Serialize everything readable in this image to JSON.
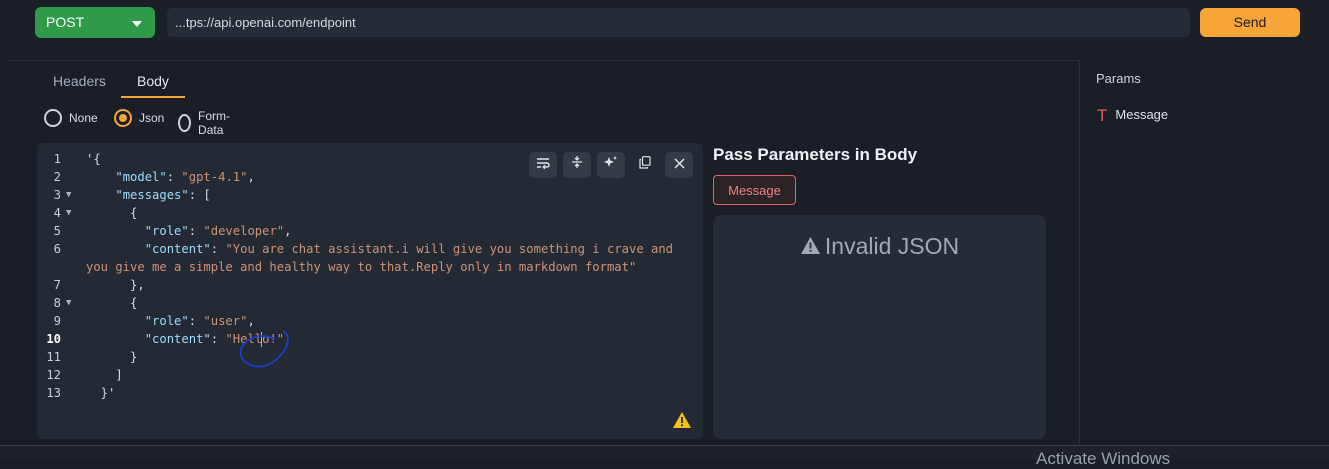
{
  "request": {
    "method": "POST",
    "url": "...tps://api.openai.com/endpoint",
    "send_label": "Send"
  },
  "tabs": [
    {
      "label": "Headers",
      "active": false
    },
    {
      "label": "Body",
      "active": true
    }
  ],
  "body_types": [
    {
      "label": "None",
      "selected": false
    },
    {
      "label": "Json",
      "selected": true
    },
    {
      "label": "Form-Data",
      "selected": false
    }
  ],
  "editor": {
    "active_line": 10,
    "lines": [
      {
        "n": "1",
        "fold": false,
        "html": "'{"
      },
      {
        "n": "2",
        "fold": false,
        "html": "    <span class=\"k\">\"model\"</span>: <span class=\"s\">\"gpt-4.1\"</span>,"
      },
      {
        "n": "3",
        "fold": true,
        "html": "    <span class=\"k\">\"messages\"</span>: ["
      },
      {
        "n": "4",
        "fold": true,
        "html": "      {"
      },
      {
        "n": "5",
        "fold": false,
        "html": "        <span class=\"k\">\"role\"</span>: <span class=\"s\">\"developer\"</span>,"
      },
      {
        "n": "6",
        "fold": false,
        "html": "        <span class=\"k\">\"content\"</span>: <span class=\"s\">\"You are chat assistant.i will give you something i crave and</span>"
      },
      {
        "n": "",
        "fold": false,
        "html": "<span class=\"s\">you give me a simple and healthy way to that.Reply only in markdown format\"</span>"
      },
      {
        "n": "7",
        "fold": false,
        "html": "      },"
      },
      {
        "n": "8",
        "fold": true,
        "html": "      {"
      },
      {
        "n": "9",
        "fold": false,
        "html": "        <span class=\"k\">\"role\"</span>: <span class=\"s\">\"user\"</span>,"
      },
      {
        "n": "10",
        "fold": false,
        "html": "        <span class=\"k\">\"content\"</span>: <span class=\"s\">\"Hello!\"</span>"
      },
      {
        "n": "11",
        "fold": false,
        "html": "      }"
      },
      {
        "n": "12",
        "fold": false,
        "html": "    ]"
      },
      {
        "n": "13",
        "fold": false,
        "html": "  }'"
      }
    ]
  },
  "pass_params": {
    "title": "Pass Parameters in Body",
    "chip": "Message",
    "invalid_text": "Invalid JSON"
  },
  "params_panel": {
    "title": "Params",
    "items": [
      {
        "label": "Message",
        "icon": "text-type-icon"
      }
    ]
  },
  "watermark": "Activate Windows",
  "colors": {
    "accent": "#f7a537",
    "method": "#2e9a4a",
    "error": "#e06464"
  }
}
